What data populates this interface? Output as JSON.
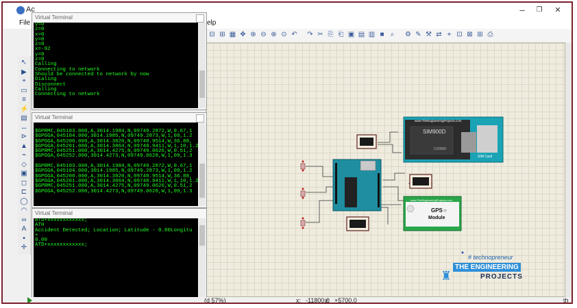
{
  "window": {
    "title": "Ac",
    "controls": {
      "minimize": "–",
      "restore": "❐",
      "close": "✕"
    }
  },
  "menu": {
    "file": "File",
    "help_fragment": "elp"
  },
  "toolbar_icons": [
    "cut",
    "copy",
    "paste",
    "grid",
    "pan",
    "zoom-in",
    "zoom-out",
    "zoom-area",
    "zoom-fit",
    "undo",
    "redo",
    "cut2",
    "copy2",
    "block-copy",
    "block-move",
    "block-rotate",
    "block-delete",
    "pick",
    "make-device",
    "package",
    "decompose",
    "wire-autorouter",
    "search",
    "property",
    "new-sheet",
    "remove-sheet",
    "netlist"
  ],
  "terminals": [
    {
      "title": "Virtual Terminal",
      "lines": [
        "y=0",
        "z=0",
        "x=0",
        "y=0",
        "z=0",
        "x=-92",
        "y=0",
        "z=0",
        "Calling",
        "Connecting to network",
        "Should be connected to network by now",
        "Dialing",
        "Disconnect",
        "Calling",
        "Connecting to network"
      ]
    },
    {
      "title": "Virtual Terminal",
      "lines": [
        "$GPRMC,045103.000,A,3014.1984,N,09749.2872,W,0.67,1",
        "$GPGGA,045104.000,3014.1985,N,09749.2873,W,1,09,1.2",
        "$GPGGA,045200.000,A,3014.3820,N,09748.9514,W,36.88,",
        "$GPGGA,045201.000,A,3014.3864,N,09748.9411,W,1,10,1.2",
        "$GPRMC,045251.000,A,3014.4275,N,09749.0626,W,0.51,2",
        "$GPGGA,045252.000,3014.4273,N,09749.0628,W,1,09,1.3",
        "",
        "$GPRMC,045103.000,A,3014.1984,N,09749.2872,W,0.67,1",
        "$GPGGA,045104.000,3014.1985,N,09749.2873,W,1,09,1.2",
        "$GPGGA,045200.000,A,3014.3820,N,09748.9514,W,36.88,",
        "$GPGGA,045201.000,A,3014.3864,N,09748.9411,W,1,10,1.2",
        "$GPRMC,045251.000,A,3014.4275,N,09749.0626,W,0.51,2",
        "$GPGGA,045252.000,3014.4273,N,09749.0628,W,1,09,1.3"
      ]
    },
    {
      "title": "Virtual Terminal",
      "lines": [
        "ATD+xxxxxxxxxxxx;",
        "ATH",
        "Accident Detected; Location; Latitude - 0.00Longitu",
        "+",
        "0.00",
        "ATD+xxxxxxxxxxxx;"
      ]
    }
  ],
  "status": {
    "zoom_fragment": "(d 57%)",
    "x_label": "x:",
    "x_value": "-11800.0",
    "y_label": "y:",
    "y_value": "+5700.0",
    "right_fragment": "th"
  },
  "schematic": {
    "sim_module": {
      "site": "www.TheEngineeringProjects.com",
      "name": "SIM900D",
      "chip": "CX0000",
      "card": "SIM Card",
      "color": "#1aa3b5"
    },
    "gps_module": {
      "site": "www.TheEngineeringProjects.com",
      "name_line1": "GPS",
      "name_line2": "Module",
      "color": "#2aa64a"
    }
  },
  "watermark": {
    "tag": "# technopreneur",
    "line1": "THE ENGINEERING",
    "line2": "PROJECTS"
  }
}
